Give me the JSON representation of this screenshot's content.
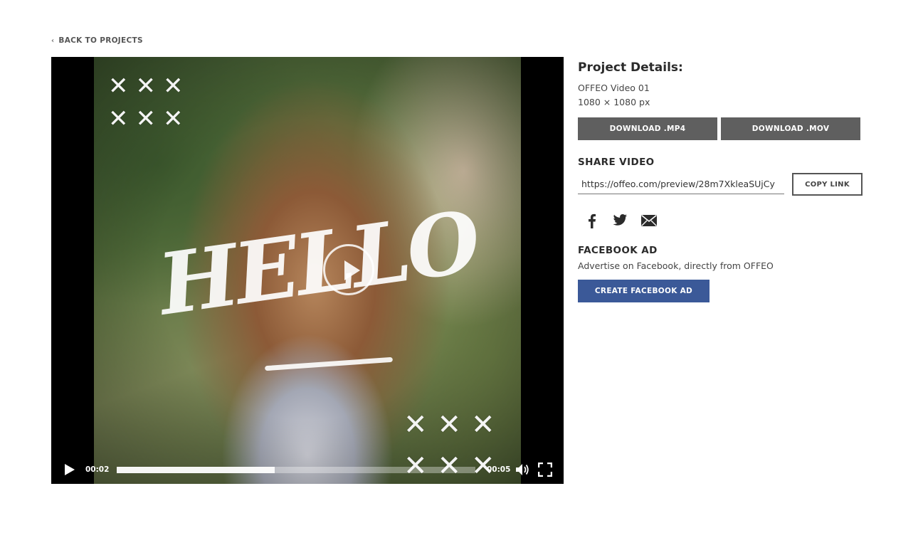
{
  "nav": {
    "back_label": "BACK TO PROJECTS",
    "back_icon": "chevron-left-icon"
  },
  "player": {
    "overlay_text": "HELLO",
    "current_time": "00:02",
    "total_time": "00:05",
    "progress": 0.44,
    "play_icon": "play-icon",
    "volume_icon": "volume-icon",
    "fullscreen_icon": "fullscreen-icon"
  },
  "details": {
    "title": "Project Details:",
    "project_name": "OFFEO Video 01",
    "dimensions": "1080 × 1080 px",
    "download_mp4": "DOWNLOAD .MP4",
    "download_mov": "DOWNLOAD .MOV"
  },
  "share": {
    "title": "SHARE VIDEO",
    "link_value": "https://offeo.com/preview/28m7XkleaSUjCy",
    "copy_label": "COPY LINK",
    "icons": [
      "facebook-icon",
      "twitter-icon",
      "email-icon"
    ]
  },
  "facebook_ad": {
    "title": "FACEBOOK AD",
    "description": "Advertise on Facebook, directly from OFFEO",
    "button_label": "CREATE FACEBOOK AD"
  },
  "colors": {
    "download_button": "#5f5f5f",
    "facebook_button": "#3b5998"
  }
}
